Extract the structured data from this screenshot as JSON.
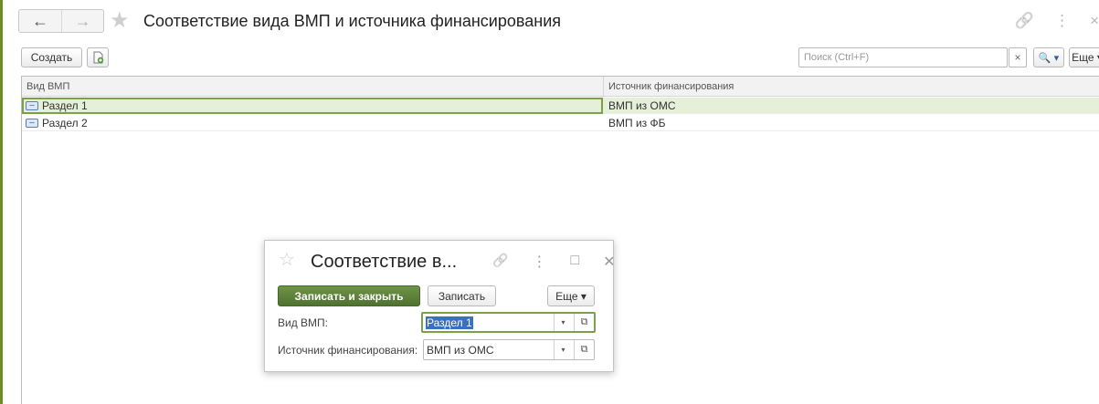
{
  "window": {
    "title": "Соответствие вида ВМП и источника финансирования"
  },
  "nav": {
    "back_icon": "←",
    "forward_icon": "→",
    "favorite_icon": "★"
  },
  "title_icons": {
    "link": "🔗",
    "more": "⋮",
    "close": "×"
  },
  "toolbar": {
    "create_label": "Создать",
    "search_placeholder": "Поиск (Ctrl+F)",
    "search_clear": "×",
    "search_button": "🔍 ▾",
    "more_label": "Еще ▾"
  },
  "table": {
    "columns": [
      "Вид ВМП",
      "Источник финансирования"
    ],
    "rows": [
      {
        "vid": "Раздел 1",
        "source": "ВМП из ОМС",
        "selected": true
      },
      {
        "vid": "Раздел 2",
        "source": "ВМП из ФБ",
        "selected": false
      }
    ]
  },
  "modal": {
    "title": "Соответствие в...",
    "favorite_icon": "☆",
    "link_icon": "🔗",
    "more_icon": "⋮",
    "maximize_icon": "□",
    "close_icon": "✕",
    "save_close_label": "Записать и закрыть",
    "save_label": "Записать",
    "more_label": "Еще ▾",
    "fields": [
      {
        "label": "Вид ВМП:",
        "value": "Раздел 1"
      },
      {
        "label": "Источник финансирования:",
        "value": "ВМП из ОМС"
      }
    ],
    "dropdown_icon": "▾",
    "open_icon": "⧉"
  },
  "colors": {
    "accent": "#4f7230",
    "selection_row": "#e6efd8",
    "selection_border": "#7aa14a",
    "text_selection": "#3b6fbf"
  }
}
